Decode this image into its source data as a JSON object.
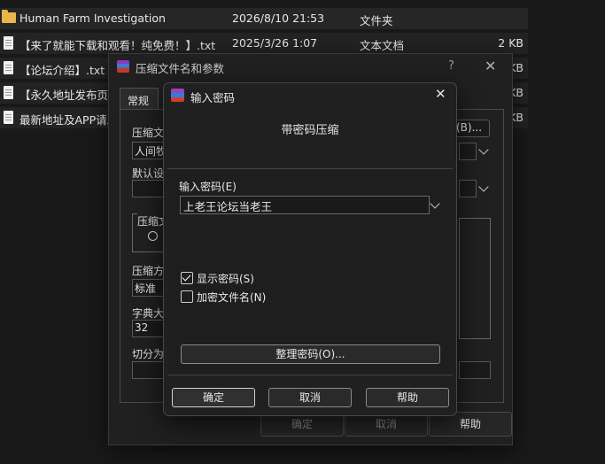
{
  "files": [
    {
      "name": "Human Farm  Investigation",
      "date": "2026/8/10 21:53",
      "type": "文件夹",
      "size": "",
      "icon": "folder-icon"
    },
    {
      "name": "【来了就能下载和观看！纯免费！】.txt",
      "date": "2025/3/26 1:07",
      "type": "文本文档",
      "size": "2 KB",
      "icon": "text-file-icon"
    },
    {
      "name": "【论坛介绍】.txt",
      "date": "",
      "type": "",
      "size": "KB",
      "icon": "text-file-icon"
    },
    {
      "name": "【永久地址发布页】",
      "date": "",
      "type": "",
      "size": "KB",
      "icon": "text-file-icon"
    },
    {
      "name": "最新地址及APP请发",
      "date": "",
      "type": "",
      "size": "KB",
      "icon": "text-file-icon"
    }
  ],
  "archive_dialog": {
    "title": "压缩文件名和参数",
    "help": "?",
    "close": "✕",
    "tab": "常规",
    "archive_name_label": "压缩文",
    "archive_name_value": "人间牧",
    "browse_button": "(B)...",
    "default_profile_label": "默认设",
    "format_label": "压缩文",
    "method_label": "压缩方",
    "method_value": "标准",
    "dict_label": "字典大",
    "dict_value": "32",
    "split_label": "切分为",
    "ok": "确定",
    "cancel": "取消",
    "help_button": "帮助"
  },
  "password_dialog": {
    "title": "输入密码",
    "close": "✕",
    "heading": "带密码压缩",
    "password_label": "输入密码(E)",
    "password_value": "上老王论坛当老王",
    "show_password": "显示密码(S)",
    "show_password_checked": true,
    "encrypt_names": "加密文件名(N)",
    "encrypt_names_checked": false,
    "organize_button": "整理密码(O)...",
    "ok": "确定",
    "cancel": "取消",
    "help": "帮助"
  }
}
